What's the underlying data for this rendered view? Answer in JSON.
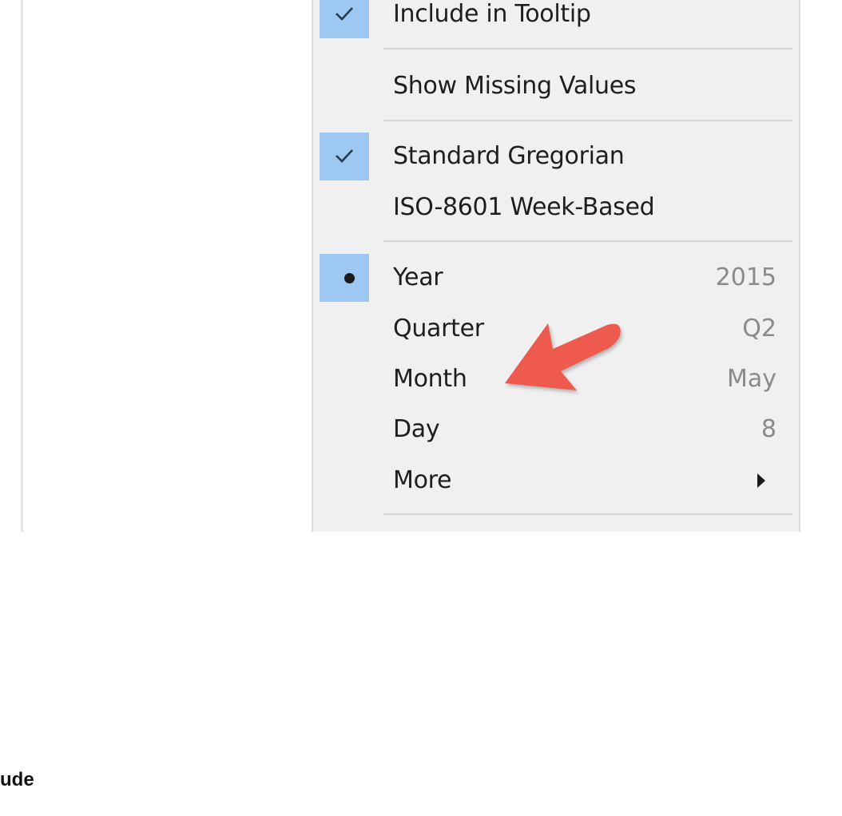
{
  "menu": {
    "items": [
      {
        "label": "Include in Tooltip",
        "checked": true
      },
      {
        "label": "Show Missing Values",
        "checked": false
      },
      {
        "label": "Standard Gregorian",
        "checked": true
      },
      {
        "label": "ISO-8601 Week-Based",
        "checked": false
      },
      {
        "label": "Year",
        "value": "2015",
        "selected": true
      },
      {
        "label": "Quarter",
        "value": "Q2"
      },
      {
        "label": "Month",
        "value": "May"
      },
      {
        "label": "Day",
        "value": "8"
      },
      {
        "label": "More",
        "has_submenu": true
      }
    ]
  },
  "annotation": {
    "arrow_color": "#ef5a4f",
    "points_to": "Month"
  },
  "footer": {
    "text": "ude"
  },
  "colors": {
    "menu_background": "#f0f0f0",
    "checked_highlight": "#9dc8f2",
    "separator": "#d6d6d6",
    "value_text": "#8a8a8a"
  },
  "icons": {
    "check": "check-icon",
    "radio": "radio-bullet-icon",
    "submenu": "submenu-arrow-icon",
    "callout": "red-arrow-icon"
  }
}
